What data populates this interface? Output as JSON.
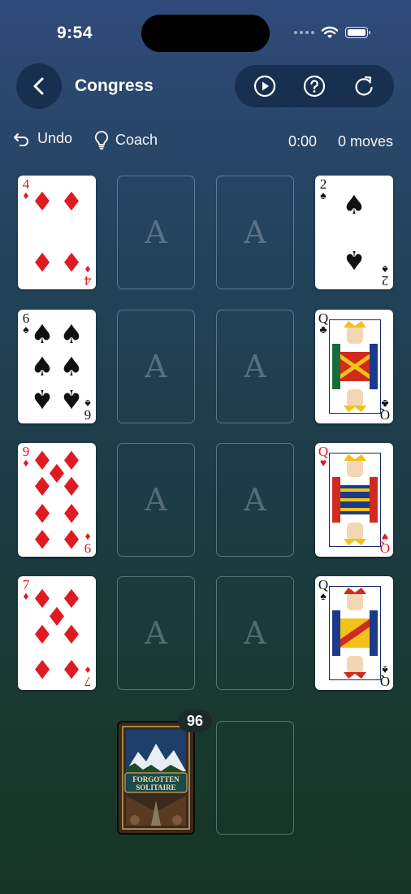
{
  "status": {
    "time": "9:54"
  },
  "header": {
    "title": "Congress"
  },
  "toolbar": {
    "undo_label": "Undo",
    "coach_label": "Coach",
    "timer": "0:00",
    "moves": "0 moves"
  },
  "foundation_letter": "A",
  "left_column": [
    {
      "rank": "4",
      "suit": "♦",
      "color": "red"
    },
    {
      "rank": "6",
      "suit": "♠",
      "color": "black"
    },
    {
      "rank": "9",
      "suit": "♦",
      "color": "red"
    },
    {
      "rank": "7",
      "suit": "♦",
      "color": "red"
    }
  ],
  "right_column": [
    {
      "rank": "2",
      "suit": "♠",
      "color": "black"
    },
    {
      "rank": "Q",
      "suit": "♣",
      "color": "black"
    },
    {
      "rank": "Q",
      "suit": "♥",
      "color": "red"
    },
    {
      "rank": "Q",
      "suit": "♠",
      "color": "black"
    }
  ],
  "stock": {
    "count": "96",
    "back_title_line1": "FORGOTTEN",
    "back_title_line2": "SOLITAIRE"
  },
  "colors": {
    "red": "#e01a22",
    "black": "#111111",
    "accent": "#18304f"
  }
}
